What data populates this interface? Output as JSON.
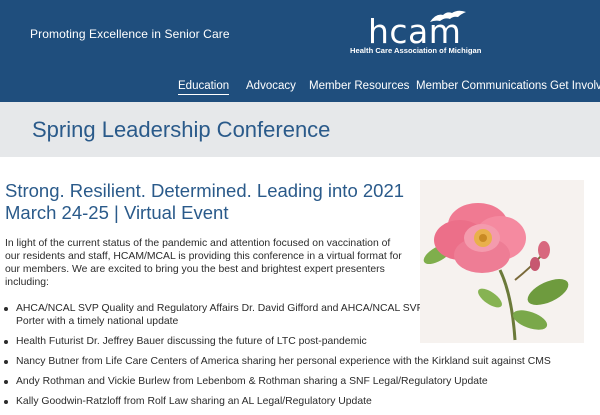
{
  "header": {
    "tagline": "Promoting Excellence in Senior Care",
    "logo_text": "hcam",
    "logo_subtitle": "Health Care Association of Michigan",
    "logo_icon": "michigan-map-icon",
    "background": "#1f4e7d"
  },
  "nav": {
    "items": [
      {
        "label": "Education",
        "active": true
      },
      {
        "label": "Advocacy",
        "active": false
      },
      {
        "label": "Member Resources",
        "active": false
      },
      {
        "label": "Member Communications",
        "active": false
      },
      {
        "label": "Get Involved",
        "active": false
      }
    ]
  },
  "page": {
    "title": "Spring Leadership Conference"
  },
  "main": {
    "headline_line1": "Strong. Resilient. Determined. Leading into 2021",
    "headline_line2": "March 24-25 | Virtual Event",
    "intro": "In light of the current status of the pandemic and attention focused on vaccination of our residents and staff, HCAM/MCAL is providing this conference in a virtual format for our members. We are excited to bring you the best and brightest expert presenters including:",
    "bullets": [
      "AHCA/NCAL SVP Quality and Regulatory Affairs Dr. David Gifford and AHCA/NCAL SVP Government Affairs Clif Porter with a timely national update",
      "Health Futurist Dr. Jeffrey Bauer discussing the future of LTC post-pandemic",
      "Nancy Butner from Life Care Centers of America sharing her personal experience with the Kirkland suit against CMS",
      "Andy Rothman and Vickie Burlew from Lebenbom & Rothman sharing a SNF Legal/Regulatory Update",
      "Kally Goodwin-Ratzloff from Rolf Law sharing an AL Legal/Regulatory Update"
    ],
    "image": "pink-rose-photo",
    "accent": "#2a5a8a"
  }
}
